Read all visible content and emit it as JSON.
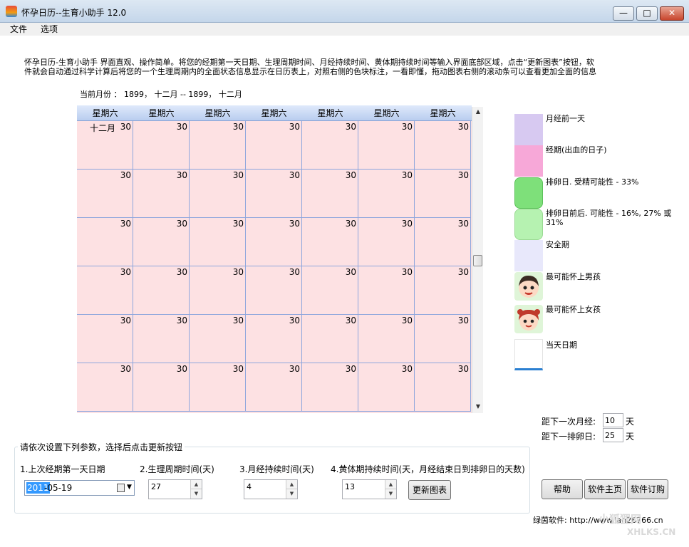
{
  "window": {
    "title": "怀孕日历--生育小助手 12.0",
    "min": "—",
    "max": "□",
    "close": "✕"
  },
  "menu": {
    "file": "文件",
    "options": "选项"
  },
  "intro": "怀孕日历-生育小助手 界面直观、操作简单。将您的经期第一天日期、生理周期时间、月经持续时间、黄体期持续时间等输入界面底部区域，点击“更新图表”按钮，软件就会自动通过科学计算后将您的一个生理周期内的全面状态信息显示在日历表上，对照右侧的色块标注，一看即懂，拖动图表右侧的滚动条可以查看更加全面的信息",
  "month_info": "当前月份 ： 1899， 十二月 -- 1899， 十二月",
  "calendar": {
    "day_names": [
      "星期六",
      "星期六",
      "星期六",
      "星期六",
      "星期六",
      "星期六",
      "星期六"
    ],
    "month_label": "十二月",
    "day_number": "30",
    "rows": 6,
    "cols": 7
  },
  "legend": [
    {
      "label": "月经前一天",
      "color": "#d7c9f1"
    },
    {
      "label": "经期(出血的日子)",
      "color": "#f7a8d8"
    },
    {
      "label": "排卵日. 受精可能性 - 33%",
      "color": "#7ee07a"
    },
    {
      "label": "排卵日前后. 可能性 - 16%, 27% 或 31%",
      "color": "#b6f2b1"
    },
    {
      "label": "安全期",
      "color": "#e8e8fb"
    },
    {
      "label": "最可能怀上男孩",
      "icon": "boy-face-icon"
    },
    {
      "label": "最可能怀上女孩",
      "icon": "girl-face-icon"
    },
    {
      "label": "当天日期",
      "color": "#ffffff"
    }
  ],
  "next": {
    "period_label": "距下一次月经:",
    "period_value": "10",
    "ovulation_label": "距下一排卵日:",
    "ovulation_value": "25",
    "unit": "天"
  },
  "params": {
    "title": "请依次设置下列参数，选择后点击更新按钮",
    "label1": "1.上次经期第一天日期",
    "label2": "2.生理周期时间(天)",
    "label3": "3.月经持续时间(天)",
    "label4": "4.黄体期持续时间(天，月经结束日到排卵日的天数)",
    "date_year": "2011",
    "date_rest": "-05-19",
    "cycle": "27",
    "duration": "4",
    "luteal": "13",
    "update_button": "更新图表"
  },
  "buttons": {
    "help": "帮助",
    "homepage": "软件主页",
    "order": "软件订购"
  },
  "footer": "绿茵软件: http://www.lan26766.cn",
  "watermark": "小狐狸网",
  "watermark2": "XHLKS.CN"
}
